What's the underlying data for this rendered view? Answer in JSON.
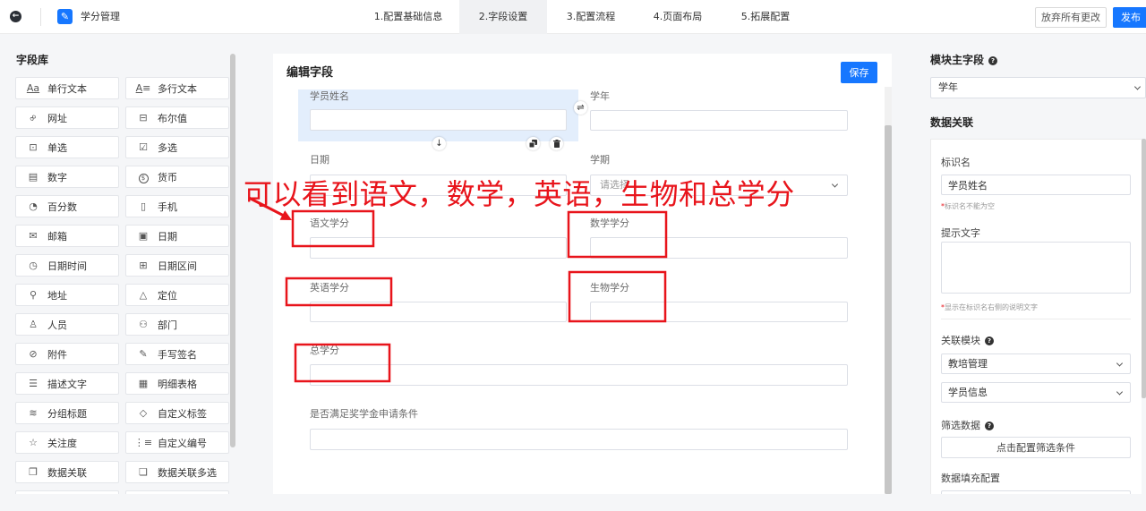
{
  "theme": {
    "accent": "#1677ff",
    "annotation_red": "#e8141b"
  },
  "app": {
    "title": "学分管理"
  },
  "steps": [
    {
      "label": "1.配置基础信息",
      "active": false
    },
    {
      "label": "2.字段设置",
      "active": true
    },
    {
      "label": "3.配置流程",
      "active": false
    },
    {
      "label": "4.页面布局",
      "active": false
    },
    {
      "label": "5.拓展配置",
      "active": false
    }
  ],
  "header": {
    "discard_label": "放弃所有更改",
    "publish_label": "发布"
  },
  "field_library": {
    "title": "字段库",
    "items": [
      {
        "label": "单行文本",
        "icon": "text-icon"
      },
      {
        "label": "多行文本",
        "icon": "multiline-text-icon"
      },
      {
        "label": "网址",
        "icon": "link-icon"
      },
      {
        "label": "布尔值",
        "icon": "toggle-icon"
      },
      {
        "label": "单选",
        "icon": "radio-icon"
      },
      {
        "label": "多选",
        "icon": "checkbox-icon"
      },
      {
        "label": "数字",
        "icon": "number-icon"
      },
      {
        "label": "货币",
        "icon": "currency-icon"
      },
      {
        "label": "百分数",
        "icon": "percent-icon"
      },
      {
        "label": "手机",
        "icon": "phone-icon"
      },
      {
        "label": "邮箱",
        "icon": "email-icon"
      },
      {
        "label": "日期",
        "icon": "calendar-icon"
      },
      {
        "label": "日期时间",
        "icon": "clock-icon"
      },
      {
        "label": "日期区间",
        "icon": "date-range-icon"
      },
      {
        "label": "地址",
        "icon": "map-pin-icon"
      },
      {
        "label": "定位",
        "icon": "location-icon"
      },
      {
        "label": "人员",
        "icon": "person-icon"
      },
      {
        "label": "部门",
        "icon": "team-icon"
      },
      {
        "label": "附件",
        "icon": "paperclip-icon"
      },
      {
        "label": "手写签名",
        "icon": "pen-icon"
      },
      {
        "label": "描述文字",
        "icon": "paragraph-icon"
      },
      {
        "label": "明细表格",
        "icon": "table-icon"
      },
      {
        "label": "分组标题",
        "icon": "layers-icon"
      },
      {
        "label": "自定义标签",
        "icon": "tag-icon"
      },
      {
        "label": "关注度",
        "icon": "star-icon"
      },
      {
        "label": "自定义编号",
        "icon": "numbered-list-icon"
      },
      {
        "label": "数据关联",
        "icon": "data-link-icon"
      },
      {
        "label": "数据关联多选",
        "icon": "data-link-multi-icon"
      }
    ]
  },
  "editor": {
    "title": "编辑字段",
    "save_label": "保存",
    "fields": [
      {
        "label": "学员姓名",
        "selected": true
      },
      {
        "label": "学年"
      },
      {
        "label": "日期"
      },
      {
        "label": "学期",
        "placeholder": "请选择"
      },
      {
        "label": "语文学分"
      },
      {
        "label": "数学学分"
      },
      {
        "label": "英语学分"
      },
      {
        "label": "生物学分"
      },
      {
        "label": "总学分"
      },
      {
        "label": "是否满足奖学金申请条件"
      }
    ]
  },
  "annotation": {
    "text": "可以看到语文，数学，英语，生物和总学分"
  },
  "right_panel": {
    "required_mark": "*",
    "main_field": {
      "title": "模块主字段",
      "value": "学年"
    },
    "data_link": {
      "title": "数据关联",
      "identifier": {
        "label": "标识名",
        "value": "学员姓名",
        "hint": "标识名不能为空"
      },
      "tip": {
        "label": "提示文字",
        "hint": "显示在标识名右侧的说明文字"
      },
      "related_module": {
        "label": "关联模块",
        "app": "教培管理",
        "form": "学员信息"
      },
      "filter": {
        "label": "筛选数据",
        "button_label": "点击配置筛选条件"
      },
      "fill_config": {
        "label": "数据填充配置"
      }
    }
  }
}
